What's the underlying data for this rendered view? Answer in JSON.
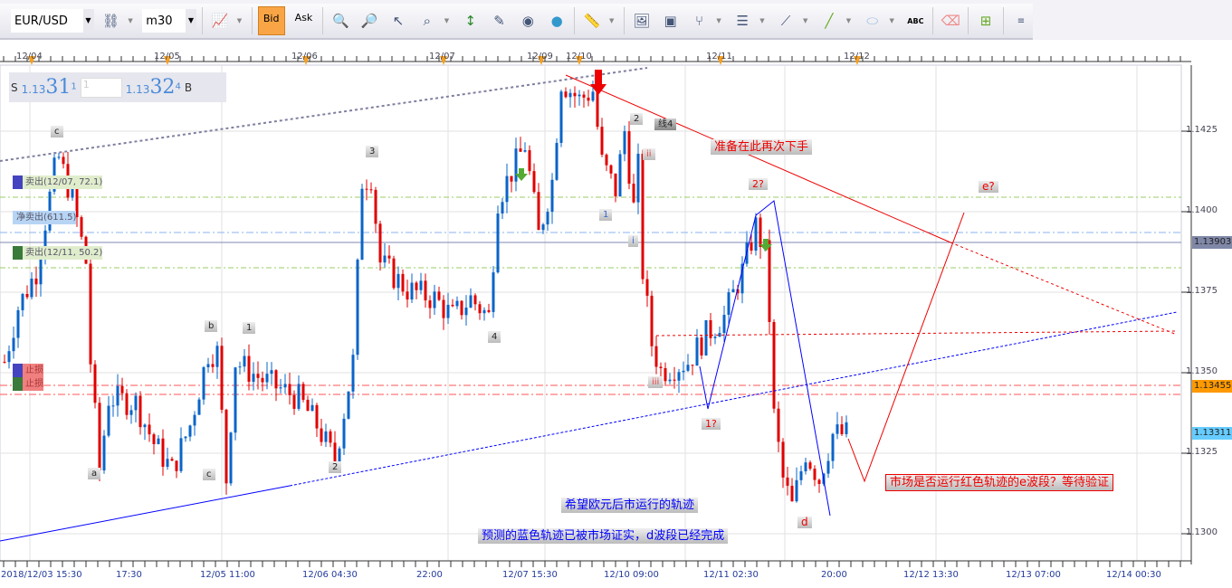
{
  "toolbar": {
    "symbol": "EUR/USD",
    "timeframe": "m30",
    "bid_label": "Bid",
    "ask_label": "Ask",
    "abc_label": "ABC"
  },
  "quote": {
    "sell_prefix": "S",
    "sell_small": "1.13",
    "sell_big": "31",
    "sell_sup": "1",
    "lot": "1",
    "buy_small": "1.13",
    "buy_big": "32",
    "buy_sup": "4",
    "buy_prefix": "B"
  },
  "top_dates": [
    "12/04",
    "12/05",
    "12/06",
    "12/07",
    "12/09",
    "12/10",
    "12/11",
    "12/12"
  ],
  "bottom_times": [
    "2018/12/03 15:30",
    "17:30",
    "12/05 11:00",
    "12/06 04:30",
    "22:00",
    "12/07 15:30",
    "12/10 09:00",
    "12/11 02:30",
    "20:00",
    "12/12 13:30",
    "12/13 07:00",
    "12/14 00:30"
  ],
  "position_tags": [
    "卖出(12/07, 72.1)",
    "净卖出(611.5)",
    "卖出(12/11, 50.2)",
    "止损",
    "止损"
  ],
  "wave_labels": [
    "c",
    "3",
    "b",
    "1",
    "a",
    "c",
    "2",
    "4",
    "2",
    "线4",
    "ii",
    "1",
    "i",
    "iii",
    "1?",
    "2?",
    "e?",
    "d"
  ],
  "annotations": {
    "prepare": "准备在此再次下手",
    "hope": "希望欧元后市运行的轨迹",
    "confirmed": "预测的蓝色轨迹已被市场证实，d波段已经完成",
    "question": "市场是否运行红色轨迹的e波段？等待验证"
  },
  "colors": {
    "up": "#0a64c8",
    "down": "#e00000",
    "current_line": "#7f87b0",
    "stop": "#ff9900",
    "last": "#66ccff"
  },
  "chart_data": {
    "type": "candlestick",
    "symbol": "EUR/USD",
    "timeframe": "m30",
    "y_ticks": [
      "1.1425",
      "1.1400",
      "1.1375",
      "1.1350",
      "1.1325",
      "1.1300"
    ],
    "ylim": [
      1.1292,
      1.1445
    ],
    "price_badges": {
      "line": "1.13903",
      "stop": "1.13455",
      "last": "1.13311"
    },
    "price_path": [
      [
        1,
        1.13534
      ],
      [
        4,
        1.13702
      ],
      [
        8,
        1.13815
      ],
      [
        12,
        1.14124
      ],
      [
        13,
        1.14166
      ],
      [
        16,
        1.14039
      ],
      [
        19,
        1.13843
      ],
      [
        20,
        1.13534
      ],
      [
        22,
        1.13197
      ],
      [
        24,
        1.13421
      ],
      [
        30,
        1.13407
      ],
      [
        34,
        1.13281
      ],
      [
        38,
        1.13197
      ],
      [
        42,
        1.13337
      ],
      [
        46,
        1.13562
      ],
      [
        48,
        1.13562
      ],
      [
        50,
        1.13169
      ],
      [
        52,
        1.13534
      ],
      [
        58,
        1.13478
      ],
      [
        66,
        1.13421
      ],
      [
        70,
        1.13337
      ],
      [
        74,
        1.13225
      ],
      [
        78,
        1.13534
      ],
      [
        80,
        1.14096
      ],
      [
        82,
        1.1411
      ],
      [
        84,
        1.13843
      ],
      [
        90,
        1.13758
      ],
      [
        96,
        1.1373
      ],
      [
        100,
        1.13674
      ],
      [
        104,
        1.1373
      ],
      [
        108,
        1.13674
      ],
      [
        110,
        1.14039
      ],
      [
        116,
        1.14208
      ],
      [
        119,
        1.13927
      ],
      [
        122,
        1.14096
      ],
      [
        124,
        1.14405
      ],
      [
        128,
        1.14348
      ],
      [
        131,
        1.14376
      ],
      [
        133,
        1.14152
      ],
      [
        136,
        1.14067
      ],
      [
        138,
        1.1425
      ],
      [
        140,
        1.14011
      ],
      [
        141,
        1.14138
      ],
      [
        142,
        1.13815
      ],
      [
        144,
        1.1359
      ],
      [
        146,
        1.13506
      ],
      [
        152,
        1.13534
      ],
      [
        156,
        1.13618
      ],
      [
        160,
        1.13674
      ],
      [
        164,
        1.13815
      ],
      [
        167,
        1.13955
      ],
      [
        169,
        1.13871
      ],
      [
        170,
        1.13674
      ],
      [
        171,
        1.13365
      ],
      [
        173,
        1.13169
      ],
      [
        175,
        1.13084
      ],
      [
        178,
        1.13253
      ],
      [
        181,
        1.13169
      ],
      [
        184,
        1.13309
      ],
      [
        187,
        1.13309
      ]
    ]
  }
}
